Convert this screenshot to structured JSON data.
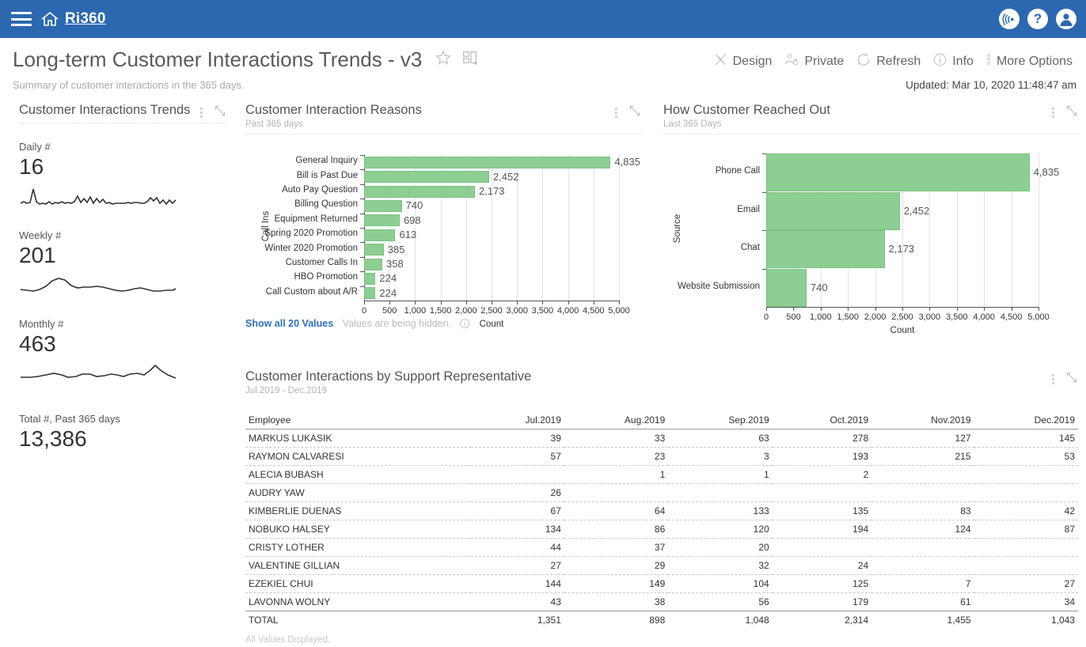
{
  "topbar": {
    "brand": "Ri360",
    "menu_icon": "hamburger-icon",
    "home_icon": "home-icon",
    "broadcast_icon": "broadcast-icon",
    "help_label": "?",
    "avatar_icon": "user-avatar-icon"
  },
  "header": {
    "title": "Long-term Customer Interactions Trends - v3",
    "subtitle": "Summary of customer interactions in the 365 days.",
    "favorite_icon": "star-icon",
    "layout_icon": "layout-grid-icon",
    "updated": "Updated: Mar 10, 2020 11:48:47 am",
    "actions": [
      {
        "label": "Design",
        "icon": "design-icon"
      },
      {
        "label": "Private",
        "icon": "private-user-icon"
      },
      {
        "label": "Refresh",
        "icon": "refresh-icon"
      },
      {
        "label": "Info",
        "icon": "info-icon"
      },
      {
        "label": "More Options",
        "icon": "more-options-icon"
      }
    ]
  },
  "trends_panel": {
    "title": "Customer Interactions Trends",
    "kpis": [
      {
        "label": "Daily #",
        "value": "16"
      },
      {
        "label": "Weekly #",
        "value": "201"
      },
      {
        "label": "Monthly #",
        "value": "463"
      }
    ],
    "total_label": "Total #, Past 365 days",
    "total_value": "13,386"
  },
  "reasons_panel": {
    "title": "Customer Interaction Reasons",
    "subtitle": "Past 365 days",
    "footer_link": "Show all 20 Values",
    "footer_hint": "Values are being hidden.",
    "footer_icon": "info-icon"
  },
  "reached_panel": {
    "title": "How Customer Reached Out",
    "subtitle": "Last 365 Days"
  },
  "rep_panel": {
    "title": "Customer Interactions by Support Representative",
    "subtitle": "Jul.2019 - Dec.2019",
    "footer": "All Values Displayed.",
    "columns": [
      "Employee",
      "Jul.2019",
      "Aug.2019",
      "Sep.2019",
      "Oct.2019",
      "Nov.2019",
      "Dec.2019"
    ],
    "rows": [
      {
        "employee": "MARKUS LUKASIK",
        "values": [
          "39",
          "33",
          "63",
          "278",
          "127",
          "145"
        ]
      },
      {
        "employee": "RAYMON CALVARESI",
        "values": [
          "57",
          "23",
          "3",
          "193",
          "215",
          "53"
        ]
      },
      {
        "employee": "ALECIA BUBASH",
        "values": [
          "",
          "1",
          "1",
          "2",
          "",
          ""
        ]
      },
      {
        "employee": "AUDRY YAW",
        "values": [
          "26",
          "",
          "",
          "",
          "",
          ""
        ]
      },
      {
        "employee": "KIMBERLIE DUENAS",
        "values": [
          "67",
          "64",
          "133",
          "135",
          "83",
          "42"
        ]
      },
      {
        "employee": "NOBUKO HALSEY",
        "values": [
          "134",
          "86",
          "120",
          "194",
          "124",
          "87"
        ]
      },
      {
        "employee": "CRISTY LOTHER",
        "values": [
          "44",
          "37",
          "20",
          "",
          "",
          ""
        ]
      },
      {
        "employee": "VALENTINE GILLIAN",
        "values": [
          "27",
          "29",
          "32",
          "24",
          "",
          ""
        ]
      },
      {
        "employee": "EZEKIEL CHUI",
        "values": [
          "144",
          "149",
          "104",
          "125",
          "7",
          "27"
        ]
      },
      {
        "employee": "LAVONNA WOLNY",
        "values": [
          "43",
          "38",
          "56",
          "179",
          "61",
          "34"
        ]
      },
      {
        "employee": "TOTAL",
        "values": [
          "1,351",
          "898",
          "1,048",
          "2,314",
          "1,455",
          "1,043"
        ],
        "is_total": true
      }
    ]
  },
  "colors": {
    "header_blue": "#2b68b0",
    "bar_green": "#8dce92",
    "link_blue": "#2f6fbd"
  },
  "chart_data": [
    {
      "id": "reasons",
      "type": "bar",
      "orientation": "horizontal",
      "title": "Customer Interaction Reasons",
      "subtitle": "Past 365 days",
      "xlabel": "Count",
      "ylabel": "Call Ins",
      "xlim": [
        0,
        5000
      ],
      "xticks": [
        "0",
        "500",
        "1,000",
        "1,500",
        "2,000",
        "2,500",
        "3,000",
        "3,500",
        "4,000",
        "4,500",
        "5,000"
      ],
      "grid": true,
      "legend": "none",
      "categories": [
        "General Inquiry",
        "Bill is Past Due",
        "Auto Pay Question",
        "Billing Question",
        "Equipment Returned",
        "Spring 2020 Promotion",
        "Winter 2020 Promotion",
        "Customer Calls In",
        "HBO Promotion",
        "Call Custom about A/R"
      ],
      "values": [
        4835,
        2452,
        2173,
        740,
        698,
        613,
        385,
        358,
        224,
        224
      ],
      "labels": [
        "4,835",
        "2,452",
        "2,173",
        "740",
        "698",
        "613",
        "385",
        "358",
        "224",
        "224"
      ]
    },
    {
      "id": "reached",
      "type": "bar",
      "orientation": "horizontal",
      "title": "How Customer Reached Out",
      "subtitle": "Last 365 Days",
      "xlabel": "Count",
      "ylabel": "Source",
      "xlim": [
        0,
        5000
      ],
      "xticks": [
        "0",
        "500",
        "1,000",
        "1,500",
        "2,000",
        "2,500",
        "3,000",
        "3,500",
        "4,000",
        "4,500",
        "5,000"
      ],
      "grid": true,
      "legend": "none",
      "categories": [
        "Phone Call",
        "Email",
        "Chat",
        "Website Submission"
      ],
      "values": [
        4835,
        2452,
        2173,
        740
      ],
      "labels": [
        "4,835",
        "2,452",
        "2,173",
        "740"
      ]
    },
    {
      "id": "sparkline-daily",
      "type": "line",
      "title": "Daily #",
      "value": 16,
      "points": [
        3,
        4,
        3,
        12,
        4,
        3,
        4,
        5,
        4,
        5,
        4,
        4,
        5,
        4,
        4,
        5,
        8,
        4,
        5,
        7,
        4,
        6,
        7,
        4,
        5,
        4,
        4,
        4,
        4,
        5,
        4,
        4,
        4,
        4,
        6,
        7,
        5,
        4,
        6,
        5,
        4
      ]
    },
    {
      "id": "sparkline-weekly",
      "type": "line",
      "title": "Weekly #",
      "value": 201,
      "points": [
        4,
        4,
        5,
        7,
        10,
        12,
        8,
        6,
        6,
        6,
        7,
        6,
        6,
        5,
        4,
        4,
        4,
        4,
        5,
        5,
        4,
        4,
        5,
        5,
        4,
        4,
        4,
        4,
        5,
        4
      ]
    },
    {
      "id": "sparkline-monthly",
      "type": "line",
      "title": "Monthly #",
      "value": 463,
      "points": [
        4,
        4,
        4,
        5,
        6,
        6,
        5,
        4,
        5,
        6,
        6,
        5,
        6,
        6,
        5,
        6,
        7,
        9,
        12,
        8,
        6,
        5,
        4,
        4
      ]
    }
  ]
}
